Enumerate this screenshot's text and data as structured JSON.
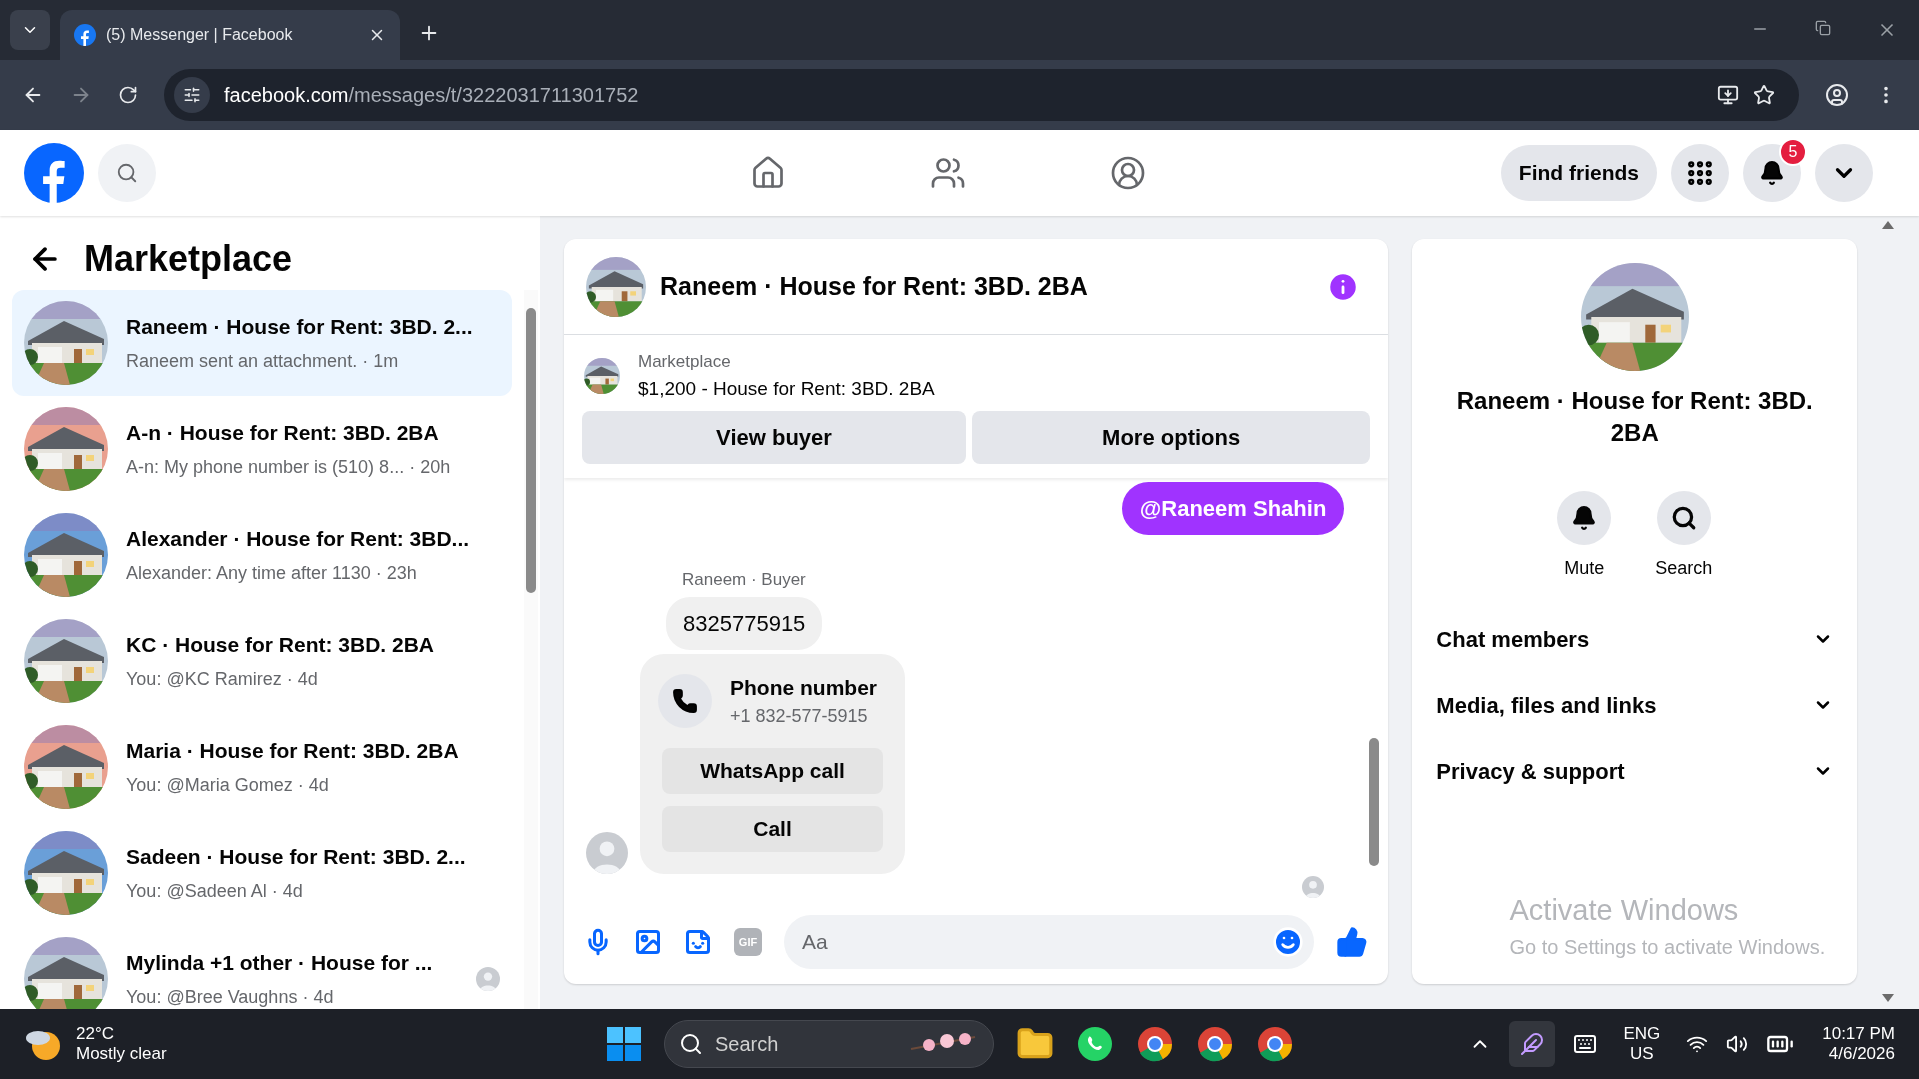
{
  "browser": {
    "tab_title": "(5) Messenger | Facebook",
    "url_host": "facebook.com",
    "url_path": "/messages/t/3222031711301752"
  },
  "header": {
    "find_friends": "Find friends",
    "notifications_badge": "5"
  },
  "sidebar": {
    "title": "Marketplace",
    "conversations": [
      {
        "title": "Raneem · House for Rent: 3BD. 2...",
        "subtitle": "Raneem sent an attachment. · 1m",
        "selected": true,
        "seen": false
      },
      {
        "title": "A-n · House for Rent: 3BD. 2BA",
        "subtitle": "A-n: My phone number is (510) 8...  · 20h",
        "selected": false,
        "seen": false
      },
      {
        "title": "Alexander · House for Rent: 3BD...",
        "subtitle": "Alexander: Any time after 1130 · 23h",
        "selected": false,
        "seen": false
      },
      {
        "title": "KC · House for Rent: 3BD. 2BA",
        "subtitle": "You: @KC Ramirez · 4d",
        "selected": false,
        "seen": false
      },
      {
        "title": "Maria · House for Rent: 3BD. 2BA",
        "subtitle": "You: @Maria Gomez · 4d",
        "selected": false,
        "seen": false
      },
      {
        "title": "Sadeen · House for Rent: 3BD. 2...",
        "subtitle": "You: @Sadeen Al · 4d",
        "selected": false,
        "seen": false
      },
      {
        "title": "Mylinda +1 other · House for ...",
        "subtitle": "You: @Bree Vaughns · 4d",
        "selected": false,
        "seen": true
      }
    ]
  },
  "chat": {
    "title": "Raneem · House for Rent: 3BD. 2BA",
    "listing": {
      "label": "Marketplace",
      "name": "$1,200 - House for Rent: 3BD. 2BA",
      "buttons": [
        "View buyer",
        "More options"
      ]
    },
    "messages": [
      {
        "kind": "outgoing",
        "text": "@Raneem Shahin"
      },
      {
        "kind": "sender",
        "text": "Raneem · Buyer"
      },
      {
        "kind": "incoming",
        "text": "8325775915"
      },
      {
        "kind": "phone_card",
        "title": "Phone number",
        "number": "+1 832-577-5915",
        "buttons": [
          "WhatsApp call",
          "Call"
        ]
      }
    ],
    "composer": {
      "placeholder": "Aa",
      "gif_label": "GIF"
    }
  },
  "details": {
    "title": "Raneem · House for Rent: 3BD. 2BA",
    "actions": [
      {
        "kind": "mute",
        "label": "Mute"
      },
      {
        "kind": "search",
        "label": "Search"
      }
    ],
    "sections": [
      {
        "label": "Chat members",
        "expanded": false
      },
      {
        "label": "Media, files and links",
        "expanded": false
      },
      {
        "label": "Privacy & support",
        "expanded": false
      }
    ],
    "activation": {
      "title": "Activate Windows",
      "hint": "Go to Settings to activate Windows."
    }
  },
  "taskbar": {
    "temperature": "22°C",
    "weather": "Mostly clear",
    "search": "Search",
    "language": "ENG",
    "region": "US",
    "time": "10:17 PM",
    "date": "4/6/2026"
  }
}
